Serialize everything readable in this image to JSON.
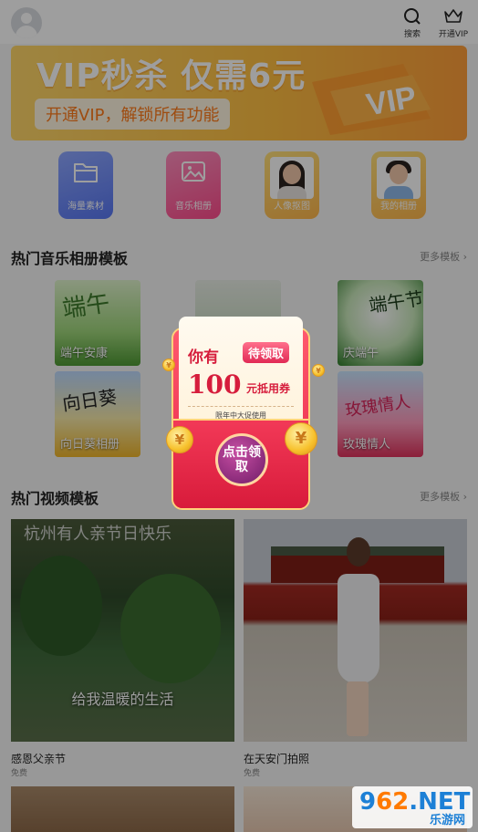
{
  "header": {
    "search_label": "搜索",
    "vip_label": "开通VIP"
  },
  "banner": {
    "title": "VIP秒杀 仅需6元",
    "subtitle": "开通VIP，解锁所有功能",
    "deco_text": "VIP"
  },
  "categories": [
    {
      "label": "海量素材",
      "icon": "folder-icon"
    },
    {
      "label": "音乐相册",
      "icon": "photo-album-icon"
    },
    {
      "label": "人像抠图",
      "icon": "portrait-cutout-icon"
    },
    {
      "label": "我的相册",
      "icon": "my-album-icon"
    }
  ],
  "music_section": {
    "title": "热门音乐相册模板",
    "more": "更多模板 ›",
    "tiles": [
      {
        "label": "端午安康",
        "art": "端午"
      },
      {
        "label": "",
        "art": ""
      },
      {
        "label": "庆端午",
        "art": "端午节"
      },
      {
        "label": "向日葵相册",
        "art": "向日葵"
      },
      {
        "label": "",
        "art": ""
      },
      {
        "label": "玫瑰情人",
        "art": "玫瑰情人"
      }
    ]
  },
  "video_section": {
    "title": "热门视频模板",
    "more": "更多模板 ›",
    "videos": [
      {
        "title": "感恩父亲节",
        "price": "免费",
        "caption": "给我温暖的生活",
        "top_caption": "杭州有人亲节日快乐"
      },
      {
        "title": "在天安门拍照",
        "price": "免费",
        "caption": "",
        "top_caption": ""
      }
    ]
  },
  "popup": {
    "you_have": "你有",
    "pending": "待领取",
    "amount": "100",
    "unit": "元抵用券",
    "note": "限年中大促使用",
    "claim": "点击领取",
    "coin_symbol": "¥"
  },
  "watermark": {
    "big_prefix": "9",
    "big_o": "62",
    "big_suffix": ".NET",
    "small": "乐游网"
  },
  "colors": {
    "accent_red": "#e52346",
    "banner_orange": "#ffc043",
    "coupon_gold": "#ffd37a"
  }
}
